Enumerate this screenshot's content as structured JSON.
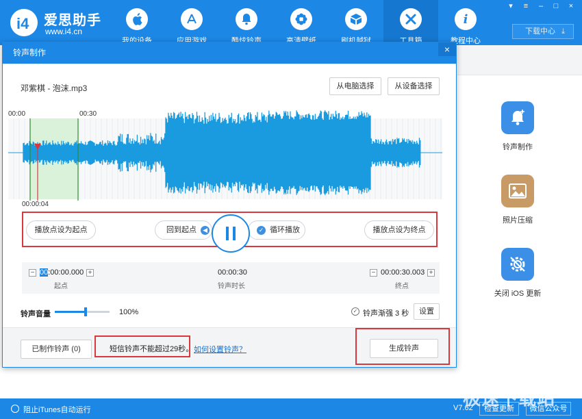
{
  "app": {
    "brand_name": "爱思助手",
    "brand_url": "www.i4.cn",
    "accent_color": "#1c87e5"
  },
  "nav": [
    {
      "label": "我的设备",
      "icon": "apple-icon"
    },
    {
      "label": "应用游戏",
      "icon": "app-store-icon"
    },
    {
      "label": "酷炫铃声",
      "icon": "bell-icon"
    },
    {
      "label": "高清壁纸",
      "icon": "flower-icon"
    },
    {
      "label": "刷机越狱",
      "icon": "box-icon"
    },
    {
      "label": "工具箱",
      "icon": "tools-icon",
      "active": true
    },
    {
      "label": "教程中心",
      "icon": "info-icon"
    }
  ],
  "window_controls": [
    "shirt-icon",
    "menu-icon",
    "minimize-icon",
    "maximize-icon",
    "close-icon"
  ],
  "download_center": "下载中心",
  "tools": [
    {
      "label": "铃声制作",
      "icon": "bell-plus-icon",
      "color": "#3c8fe6"
    },
    {
      "label": "照片压缩",
      "icon": "image-icon",
      "color": "#c89a66"
    },
    {
      "label": "关闭 iOS 更新",
      "icon": "gear-off-icon",
      "color": "#3c8fe6"
    }
  ],
  "status": {
    "itunes_label": "阻止iTunes自动运行",
    "version": "V7.62",
    "check_update": "检查更新",
    "wechat": "微信公众号"
  },
  "dialog": {
    "title": "铃声制作",
    "close": "×",
    "file_name": "邓紫棋 - 泡沫.mp3",
    "from_pc": "从电脑选择",
    "from_device": "从设备选择",
    "time_start": "00:00",
    "time_mark": "00:30",
    "time_current": "00:00:04",
    "set_start": "播放点设为起点",
    "back_to_start": "回到起点",
    "loop_play": "循环播放",
    "set_end": "播放点设为终点",
    "start_value": "00:00:00.000",
    "start_sel": "00",
    "start_rest": ":00:00.000",
    "start_label": "起点",
    "length_value": "00:00:30",
    "length_label": "铃声时长",
    "end_value": "00:00:30.003",
    "end_label": "终点",
    "volume_label": "铃声音量",
    "volume_value": "100%",
    "volume_level": 0.56,
    "fade_label": "铃声渐强 3 秒",
    "settings": "设置",
    "made_ringtones": "已制作铃声 (0)",
    "warning": "短信铃声不能超过29秒。",
    "help_link": "如何设置铃声？",
    "generate": "生成铃声"
  },
  "watermark": "极速下载站"
}
